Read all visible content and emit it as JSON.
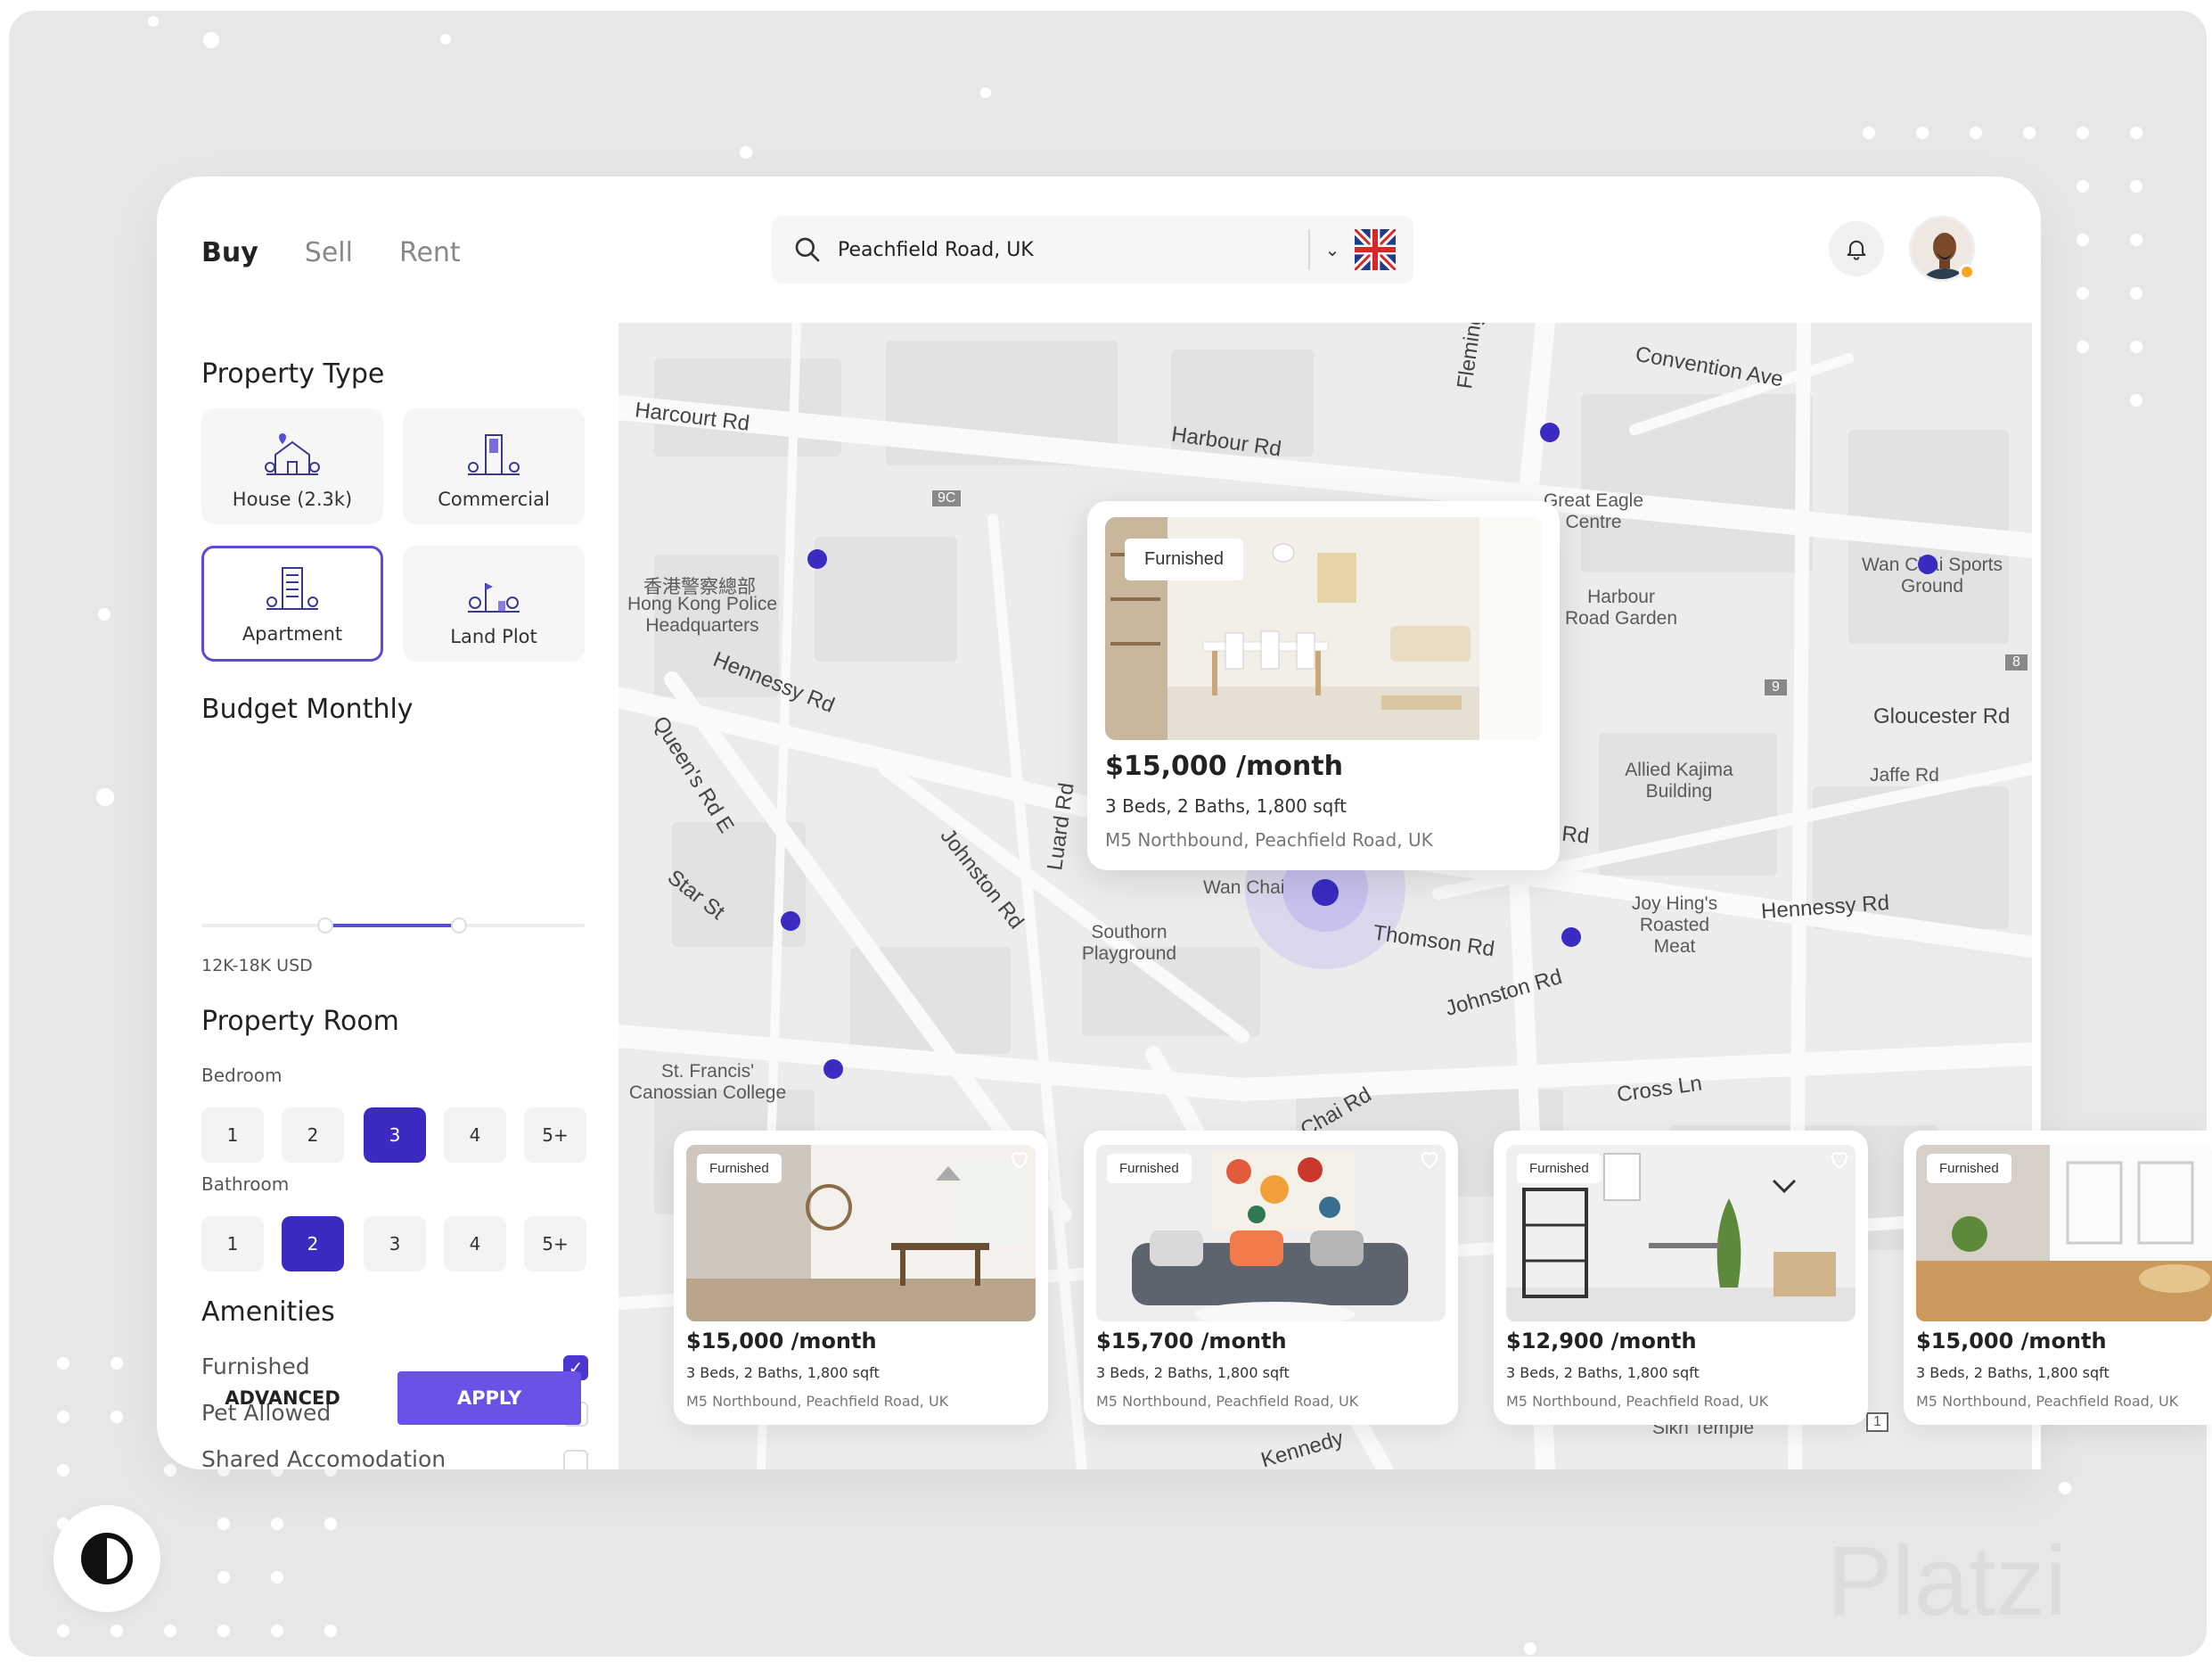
{
  "nav": {
    "tabs": [
      "Buy",
      "Sell",
      "Rent"
    ],
    "active": "Buy"
  },
  "search": {
    "value": "Peachfield Road, UK"
  },
  "sidebar": {
    "property_type_title": "Property Type",
    "property_types": [
      "House (2.3k)",
      "Commercial",
      "Apartment",
      "Land Plot"
    ],
    "selected_type": "Apartment",
    "budget_title": "Budget Monthly",
    "budget_range": "12K-18K USD",
    "room_title": "Property Room",
    "bedroom_label": "Bedroom",
    "bedroom_options": [
      "1",
      "2",
      "3",
      "4",
      "5+"
    ],
    "bedroom_selected": "3",
    "bathroom_label": "Bathroom",
    "bathroom_options": [
      "1",
      "2",
      "3",
      "4",
      "5+"
    ],
    "bathroom_selected": "2",
    "amenities_title": "Amenities",
    "amenities": [
      {
        "label": "Furnished",
        "checked": true
      },
      {
        "label": "Pet Allowed",
        "checked": false
      },
      {
        "label": "Shared Accomodation",
        "checked": false
      }
    ],
    "advanced_label": "ADVANCED",
    "apply_label": "APPLY"
  },
  "map_labels": {
    "harcourt": "Harcourt Rd",
    "harbour": "Harbour Rd",
    "fleming": "Fleming Rd",
    "convention": "Convention Ave",
    "great_eagle": "Great Eagle Centre",
    "harbour_garden": "Harbour Road Garden",
    "wanchai_sports": "Wan Chai Sports Ground",
    "police_cn": "香港警察總部",
    "police": "Hong Kong Police Headquarters",
    "hennessy1": "Hennessy Rd",
    "queens": "Queen's Rd E",
    "star": "Star St",
    "johnston1": "Johnston Rd",
    "luard": "Luard Rd",
    "gloucester": "Gloucester Rd",
    "jaffe": "Jaffe Rd",
    "allied": "Allied Kajima Building",
    "lockhart": "Lockhart Rd",
    "wanchai": "Wan Chai",
    "southorn": "Southorn Playground",
    "thomson": "Thomson Rd",
    "joyhing": "Joy Hing's Roasted Meat",
    "hennessy2": "Hennessy Rd",
    "johnston2": "Johnston Rd",
    "stfrancis": "St. Francis' Canossian College",
    "chai": "Chai Rd",
    "cross": "Cross Ln",
    "kennedy": "Kennedy",
    "sikh": "Sikh Temple",
    "route9c": "9C",
    "route9": "9",
    "route8": "8",
    "route1": "1"
  },
  "featured": {
    "badge": "Furnished",
    "price": "$15,000 /month",
    "specs": "3 Beds, 2 Baths, 1,800 sqft",
    "address": "M5 Northbound, Peachfield Road, UK"
  },
  "listings": [
    {
      "badge": "Furnished",
      "price": "$15,000 /month",
      "specs": "3 Beds, 2 Baths, 1,800 sqft",
      "address": "M5 Northbound, Peachfield Road, UK"
    },
    {
      "badge": "Furnished",
      "price": "$15,700 /month",
      "specs": "3 Beds, 2 Baths, 1,800 sqft",
      "address": "M5 Northbound, Peachfield Road, UK"
    },
    {
      "badge": "Furnished",
      "price": "$12,900 /month",
      "specs": "3 Beds, 2 Baths, 1,800 sqft",
      "address": "M5 Northbound, Peachfield Road, UK"
    },
    {
      "badge": "Furnished",
      "price": "$15,000 /month",
      "specs": "3 Beds, 2 Baths, 1,800 sqft",
      "address": "M5 Northbound, Peachfield Road, UK"
    }
  ],
  "watermark": "Platzi",
  "colors": {
    "accent": "#3b2bc1",
    "apply": "#6c51e6"
  },
  "icons": [
    "search-icon",
    "chevron-down-icon",
    "uk-flag-icon",
    "bell-icon",
    "avatar",
    "heart-icon",
    "theme-toggle-icon"
  ]
}
